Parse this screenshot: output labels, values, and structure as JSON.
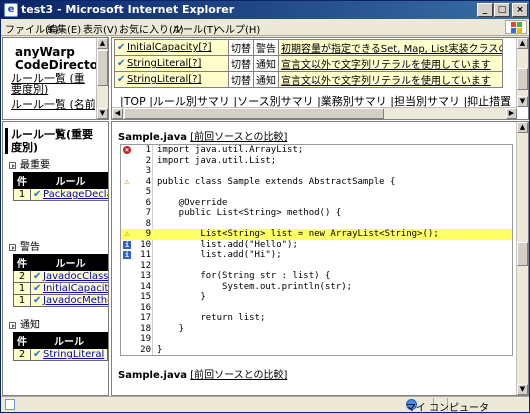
{
  "window": {
    "title": "test3 - Microsoft Internet Explorer",
    "app_icon": "e",
    "buttons": {
      "minimize": "_",
      "maximize": "□",
      "close": "×"
    }
  },
  "menubar": [
    "ファイル(F)",
    "編集(E)",
    "表示(V)",
    "お気に入り(A)",
    "ツール(T)",
    "ヘルプ(H)"
  ],
  "top_left": {
    "app_name_line1": "anyWarp",
    "app_name_line2": "CodeDirector",
    "links": [
      "ルール一覧 (重要度別)",
      "ルール一覧 (名前順)"
    ]
  },
  "left_nav": {
    "heading": "ルール一覧(重要度別)",
    "sections": [
      {
        "title": "最重要",
        "headers": [
          "件",
          "ルール"
        ],
        "rows": [
          {
            "count": "1",
            "rule": "PackageDeclaration"
          }
        ]
      },
      {
        "title": "警告",
        "headers": [
          "件",
          "ルール"
        ],
        "rows": [
          {
            "count": "2",
            "rule": "JavadocClass"
          },
          {
            "count": "1",
            "rule": "InitialCapacity"
          },
          {
            "count": "1",
            "rule": "JavadocMethod"
          }
        ]
      },
      {
        "title": "通知",
        "headers": [
          "件",
          "ルール"
        ],
        "rows": [
          {
            "count": "2",
            "rule": "StringLiteral"
          }
        ]
      }
    ]
  },
  "violations": {
    "rows": [
      {
        "rule": "InitialCapacity[?]",
        "person": "切替",
        "severity": "警告",
        "message": "初期容量が指定できるSet, Map, List実装クラスの初期容量を指定しています"
      },
      {
        "rule": "StringLiteral[?]",
        "person": "切替",
        "severity": "通知",
        "message": "宣言文以外で文字列リテラルを使用しています"
      },
      {
        "rule": "StringLiteral[?]",
        "person": "切替",
        "severity": "通知",
        "message": "宣言文以外で文字列リテラルを使用しています"
      }
    ],
    "nav_links": "|TOP |ルール別サマリ |ソース別サマリ |業務別サマリ |担当別サマリ |抑止措置 |ルール一覧"
  },
  "code_view": {
    "file_name": "Sample.java",
    "compare_link": "[前回ソースとの比較]",
    "lines": [
      {
        "num": "1",
        "code": "import java.util.ArrayList;",
        "marker": "err"
      },
      {
        "num": "2",
        "code": "import java.util.List;",
        "marker": ""
      },
      {
        "num": "3",
        "code": "",
        "marker": ""
      },
      {
        "num": "4",
        "code": "public class Sample extends AbstractSample {",
        "marker": "warn"
      },
      {
        "num": "5",
        "code": "",
        "marker": ""
      },
      {
        "num": "6",
        "code": "    @Override",
        "marker": ""
      },
      {
        "num": "7",
        "code": "    public List<String> method() {",
        "marker": ""
      },
      {
        "num": "8",
        "code": "",
        "marker": ""
      },
      {
        "num": "9",
        "code": "        List<String> list = new ArrayList<String>();",
        "marker": "warn",
        "highlight": true
      },
      {
        "num": "10",
        "code": "        list.add(\"Hello\");",
        "marker": "info"
      },
      {
        "num": "11",
        "code": "        list.add(\"Hi\");",
        "marker": "info"
      },
      {
        "num": "12",
        "code": "",
        "marker": ""
      },
      {
        "num": "13",
        "code": "        for(String str : list) {",
        "marker": ""
      },
      {
        "num": "14",
        "code": "            System.out.println(str);",
        "marker": ""
      },
      {
        "num": "15",
        "code": "        }",
        "marker": ""
      },
      {
        "num": "16",
        "code": "",
        "marker": ""
      },
      {
        "num": "17",
        "code": "        return list;",
        "marker": ""
      },
      {
        "num": "18",
        "code": "    }",
        "marker": ""
      },
      {
        "num": "19",
        "code": "",
        "marker": ""
      },
      {
        "num": "20",
        "code": "}",
        "marker": ""
      }
    ]
  },
  "statusbar": {
    "zone": "マイ コンピュータ"
  },
  "colors": {
    "title_bar": "#0a246a",
    "table_row_bg": "#ffffcc",
    "highlight_line": "#ffff66",
    "link": "#0000cc"
  }
}
